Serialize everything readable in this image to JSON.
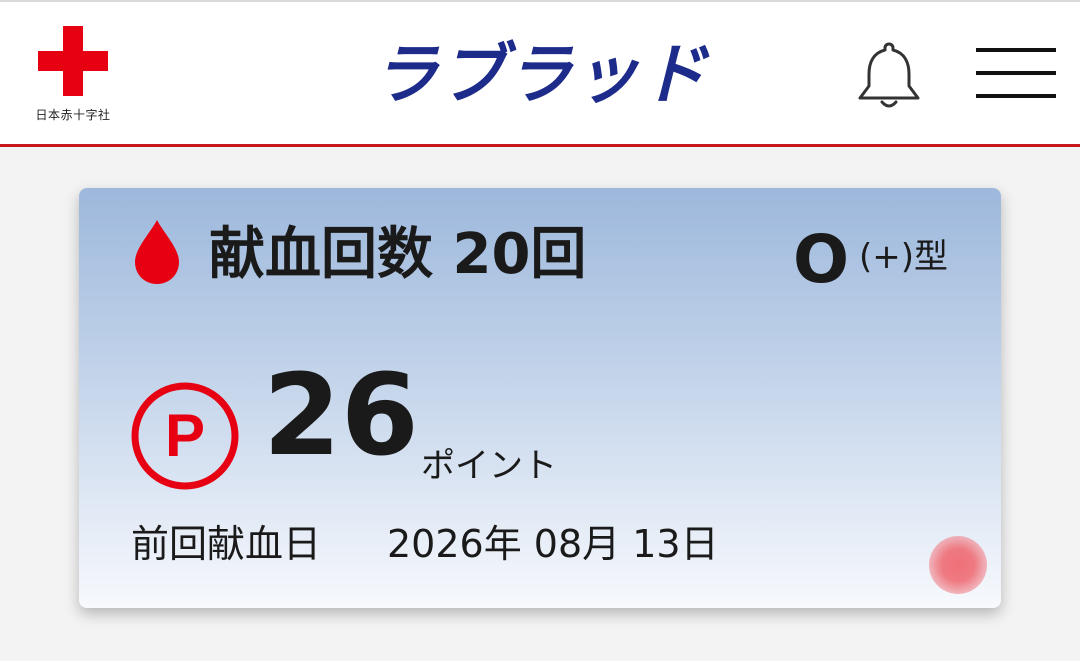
{
  "header": {
    "logo_text": "日本赤十字社",
    "app_title": "ラブラッド"
  },
  "card": {
    "donation_count": "献血回数 20回",
    "blood_type": "O",
    "blood_type_suffix": "(+)型",
    "points_value": "26",
    "points_unit": "ポイント",
    "last_donation_label": "前回献血日",
    "last_donation_date": "2026年 08月 13日"
  },
  "icons": {
    "logo": "red-cross-icon",
    "notifications": "bell-icon",
    "menu": "hamburger-menu-icon",
    "blood": "blood-drop-icon",
    "points": "p-circle-icon"
  },
  "colors": {
    "brand_red": "#e60012",
    "title_blue": "#1d2b8a",
    "header_border": "#c8161d"
  }
}
